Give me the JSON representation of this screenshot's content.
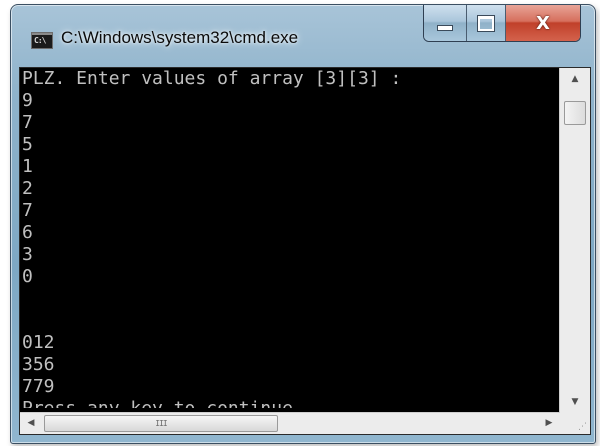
{
  "window": {
    "title": "C:\\Windows\\system32\\cmd.exe",
    "icon_label": "C:\\"
  },
  "caption_buttons": {
    "minimize_icon": "minimize-icon",
    "maximize_icon": "maximize-icon",
    "close_icon": "close-icon",
    "close_glyph": "X"
  },
  "console": {
    "text_color": "#c0c0c0",
    "background": "#000000",
    "lines": [
      "PLZ. Enter values of array [3][3] :",
      "9",
      "7",
      "5",
      "1",
      "2",
      "7",
      "6",
      "3",
      "0",
      "",
      "",
      "012",
      "356",
      "779",
      "Press any key to continue . . ."
    ]
  },
  "scrollbars": {
    "up_arrow": "▲",
    "down_arrow": "▼",
    "left_arrow": "◀",
    "right_arrow": "▶",
    "grip": "III",
    "size_grip": "⋰"
  }
}
